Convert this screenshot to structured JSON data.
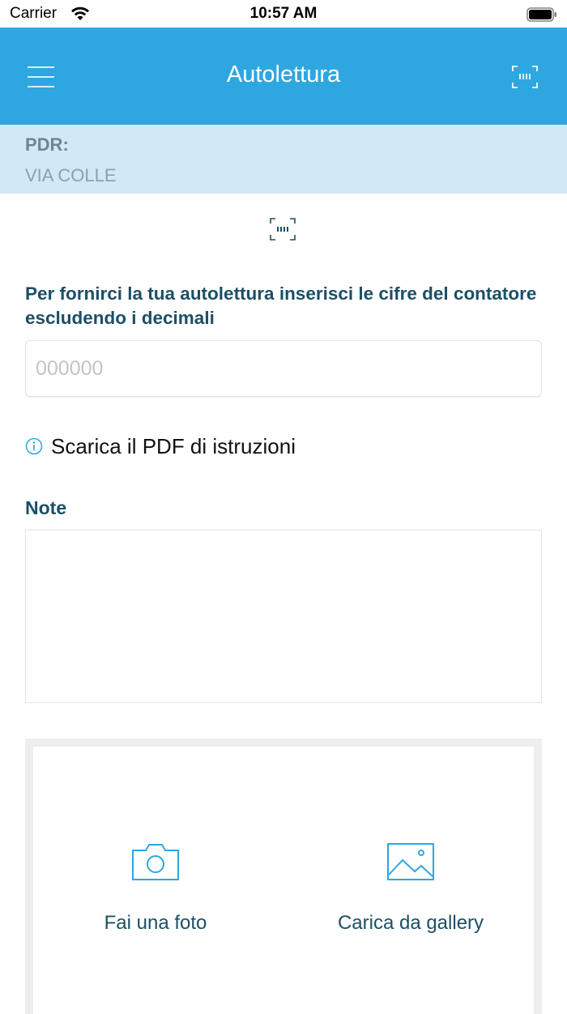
{
  "status_bar": {
    "carrier": "Carrier",
    "time": "10:57 AM"
  },
  "nav": {
    "title": "Autolettura",
    "left_icon": "hamburger-menu-icon",
    "right_icon": "barcode-scan-icon",
    "background_color": "#2ea7e0"
  },
  "meter": {
    "pdr_label": "PDR:",
    "address": "VIA COLLE"
  },
  "form": {
    "instruction": "Per fornirci la tua autolettura inserisci le cifre del contatore escludendo i decimali",
    "reading_placeholder": "000000",
    "reading_value": "",
    "pdf_link_label": "Scarica il PDF di istruzioni",
    "note_label": "Note",
    "note_value": ""
  },
  "photo": {
    "camera_label": "Fai una foto",
    "gallery_label": "Carica da gallery"
  },
  "colors": {
    "accent": "#2ea7e0",
    "heading_text": "#1c4f66",
    "banner_bg": "#d2e8f4"
  }
}
